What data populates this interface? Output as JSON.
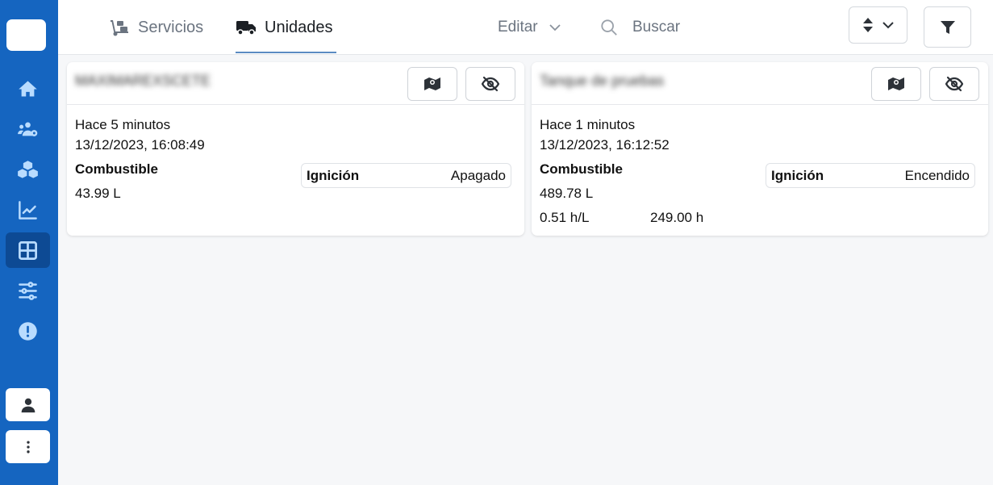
{
  "sidebar": {
    "items": [
      {
        "name": "home-icon"
      },
      {
        "name": "users-settings-icon"
      },
      {
        "name": "cubes-icon"
      },
      {
        "name": "chart-line-icon"
      },
      {
        "name": "dashboard-grid-icon",
        "active": true
      },
      {
        "name": "sliders-icon"
      },
      {
        "name": "alert-icon"
      }
    ],
    "bottom": [
      "user-icon",
      "more-vertical-icon"
    ]
  },
  "header": {
    "tabs": [
      {
        "label": "Servicios",
        "icon": "dolly-icon",
        "active": false
      },
      {
        "label": "Unidades",
        "icon": "truck-icon",
        "active": true
      }
    ],
    "edit_label": "Editar",
    "search_placeholder": "Buscar"
  },
  "cards": [
    {
      "title": "MAXIMAREXSCETE",
      "ago": "Hace 5 minutos",
      "date": "13/12/2023, 16:08:49",
      "fuel_label": "Combustible",
      "fuel_value": "43.99 L",
      "ignition_label": "Ignición",
      "ignition_value": "Apagado"
    },
    {
      "title": "Tanque de pruebas",
      "ago": "Hace 1 minutos",
      "date": "13/12/2023, 16:12:52",
      "fuel_label": "Combustible",
      "fuel_value": "489.78 L",
      "rate": "0.51 h/L",
      "hours": "249.00 h",
      "ignition_label": "Ignición",
      "ignition_value": "Encendido"
    }
  ],
  "colors": {
    "sidebar": "#1565c0",
    "sidebar_active": "#0d4a94",
    "sidebar_icon": "#b9dcff",
    "tab_underline": "#5b8bc2"
  }
}
